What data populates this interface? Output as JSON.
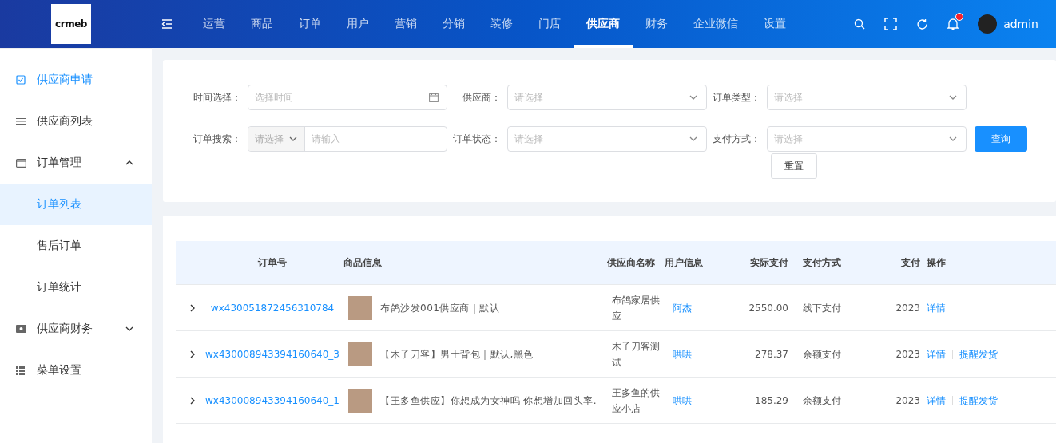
{
  "header": {
    "logo": "crmeb",
    "nav": [
      {
        "label": "运营",
        "selected": false
      },
      {
        "label": "商品",
        "selected": false
      },
      {
        "label": "订单",
        "selected": false
      },
      {
        "label": "用户",
        "selected": false
      },
      {
        "label": "营销",
        "selected": false
      },
      {
        "label": "分销",
        "selected": false
      },
      {
        "label": "装修",
        "selected": false
      },
      {
        "label": "门店",
        "selected": false
      },
      {
        "label": "供应商",
        "selected": true
      },
      {
        "label": "财务",
        "selected": false
      },
      {
        "label": "企业微信",
        "selected": false
      },
      {
        "label": "设置",
        "selected": false
      }
    ],
    "has_unread": true,
    "user": "admin"
  },
  "sidebar": {
    "items": [
      {
        "label": "供应商申请",
        "active": true
      },
      {
        "label": "供应商列表",
        "active": false
      },
      {
        "label": "订单管理",
        "active": false,
        "expanded": true,
        "children": [
          {
            "label": "订单列表",
            "selected": true
          },
          {
            "label": "售后订单",
            "selected": false
          },
          {
            "label": "订单统计",
            "selected": false
          }
        ]
      },
      {
        "label": "供应商财务",
        "active": false,
        "expanded": false
      },
      {
        "label": "菜单设置",
        "active": false
      }
    ]
  },
  "filters": {
    "fields": [
      {
        "label": "时间选择：",
        "kind": "date",
        "placeholder": "选择时间"
      },
      {
        "label": "供应商：",
        "kind": "select",
        "placeholder": "请选择"
      },
      {
        "label": "订单类型：",
        "kind": "select",
        "placeholder": "请选择"
      },
      {
        "label": "订单搜索：",
        "kind": "combo",
        "select_placeholder": "请选择",
        "placeholder": "请输入"
      },
      {
        "label": "订单状态：",
        "kind": "select",
        "placeholder": "请选择"
      },
      {
        "label": "支付方式：",
        "kind": "select",
        "placeholder": "请选择"
      }
    ],
    "search_button": "查询",
    "reset_button": "重置"
  },
  "table": {
    "columns": [
      "订单号",
      "商品信息",
      "供应商名称",
      "用户信息",
      "实际支付",
      "支付方式",
      "支付",
      "操作"
    ],
    "rows": [
      {
        "order_no": "wx430051872456310784",
        "product": "布鸽沙发001供应商｜默认",
        "supplier": "布鸽家居供应",
        "user": "阿杰",
        "amount": "2550.00",
        "pay_method": "线下支付",
        "pay_time": "2023",
        "actions": [
          "详情"
        ]
      },
      {
        "order_no": "wx430008943394160640_3",
        "product": "【木子刀客】男士背包｜默认,黑色",
        "supplier": "木子刀客测试",
        "user": "哄哄",
        "amount": "278.37",
        "pay_method": "余额支付",
        "pay_time": "2023",
        "actions": [
          "详情",
          "提醒发货"
        ]
      },
      {
        "order_no": "wx430008943394160640_1",
        "product": "【王多鱼供应】你想成为女神吗 你想增加回头率.",
        "supplier": "王多鱼的供应小店",
        "user": "哄哄",
        "amount": "185.29",
        "pay_method": "余额支付",
        "pay_time": "2023",
        "actions": [
          "详情",
          "提醒发货"
        ]
      }
    ]
  }
}
